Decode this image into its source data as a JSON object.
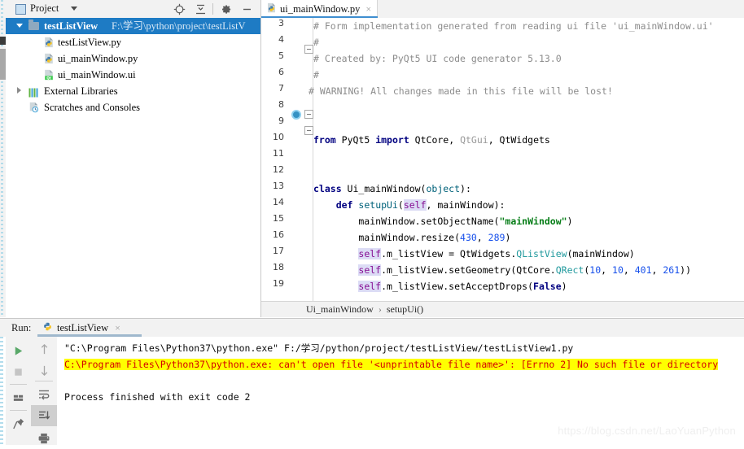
{
  "project_panel": {
    "title": "Project",
    "icons": [
      "locate-target-icon",
      "collapse-all-icon",
      "settings-gear-icon",
      "minimize-icon"
    ],
    "tree": [
      {
        "label": "testListView",
        "path": "F:\\学习\\python\\project\\testListV",
        "icon": "folder-icon",
        "expanded": true,
        "selected": true,
        "indent": 0
      },
      {
        "label": "testListView.py",
        "path": "",
        "icon": "python-file-icon",
        "expanded": null,
        "selected": false,
        "indent": 1
      },
      {
        "label": "ui_mainWindow.py",
        "path": "",
        "icon": "python-file-icon",
        "expanded": null,
        "selected": false,
        "indent": 1
      },
      {
        "label": "ui_mainWindow.ui",
        "path": "",
        "icon": "qt-designer-file-icon",
        "expanded": null,
        "selected": false,
        "indent": 1
      },
      {
        "label": "External Libraries",
        "path": "",
        "icon": "libraries-icon",
        "expanded": false,
        "selected": false,
        "indent": 0
      },
      {
        "label": "Scratches and Consoles",
        "path": "",
        "icon": "scratches-icon",
        "expanded": null,
        "selected": false,
        "indent": 0
      }
    ]
  },
  "editor": {
    "tab": {
      "name": "ui_mainWindow.py",
      "icon": "python-file-icon",
      "close": "×"
    },
    "first_line_number": 3,
    "lines": [
      {
        "n": 3,
        "tokens": [
          {
            "t": "# Form implementation generated from reading ui file 'ui_mainWindow.ui'",
            "c": "cmt"
          }
        ],
        "indent": 0
      },
      {
        "n": 4,
        "tokens": [
          {
            "t": "#",
            "c": "cmt"
          }
        ],
        "indent": 0
      },
      {
        "n": 5,
        "tokens": [
          {
            "t": "# Created by: PyQt5 UI code generator 5.13.0",
            "c": "cmt"
          }
        ],
        "indent": 0
      },
      {
        "n": 6,
        "tokens": [
          {
            "t": "#",
            "c": "cmt"
          }
        ],
        "indent": 0
      },
      {
        "n": 7,
        "tokens": [
          {
            "t": "# WARNING! All changes made in this file will be lost!",
            "c": "cmt"
          }
        ],
        "indent": -1
      },
      {
        "n": 8,
        "tokens": [],
        "indent": 0
      },
      {
        "n": 9,
        "tokens": [],
        "indent": 0
      },
      {
        "n": 10,
        "tokens": [
          {
            "t": "from",
            "c": "k"
          },
          {
            "t": " ",
            "c": "id"
          },
          {
            "t": "PyQt5",
            "c": "id"
          },
          {
            "t": " ",
            "c": "id"
          },
          {
            "t": "import",
            "c": "k"
          },
          {
            "t": " QtCore, ",
            "c": "id"
          },
          {
            "t": "QtGui",
            "c": "grey"
          },
          {
            "t": ", QtWidgets",
            "c": "id"
          }
        ],
        "indent": 0
      },
      {
        "n": 11,
        "tokens": [],
        "indent": 0
      },
      {
        "n": 12,
        "tokens": [],
        "indent": 0
      },
      {
        "n": 13,
        "tokens": [
          {
            "t": "class",
            "c": "k"
          },
          {
            "t": " Ui_mainWindow(",
            "c": "id"
          },
          {
            "t": "object",
            "c": "fn"
          },
          {
            "t": "):",
            "c": "id"
          }
        ],
        "indent": 0
      },
      {
        "n": 14,
        "tokens": [
          {
            "t": "    ",
            "c": "id"
          },
          {
            "t": "def",
            "c": "k"
          },
          {
            "t": " ",
            "c": "id"
          },
          {
            "t": "setupUi",
            "c": "fn"
          },
          {
            "t": "(",
            "c": "id"
          },
          {
            "t": "self",
            "c": "selfhl"
          },
          {
            "t": ", mainWindow):",
            "c": "id"
          }
        ],
        "indent": 0
      },
      {
        "n": 15,
        "tokens": [
          {
            "t": "        mainWindow.setObjectName(",
            "c": "id"
          },
          {
            "t": "\"mainWindow\"",
            "c": "str"
          },
          {
            "t": ")",
            "c": "id"
          }
        ],
        "indent": 0
      },
      {
        "n": 16,
        "tokens": [
          {
            "t": "        mainWindow.resize(",
            "c": "id"
          },
          {
            "t": "430",
            "c": "num"
          },
          {
            "t": ", ",
            "c": "id"
          },
          {
            "t": "289",
            "c": "num"
          },
          {
            "t": ")",
            "c": "id"
          }
        ],
        "indent": 0
      },
      {
        "n": 17,
        "tokens": [
          {
            "t": "        ",
            "c": "id"
          },
          {
            "t": "self",
            "c": "selfhl"
          },
          {
            "t": ".m_listView = QtWidgets.",
            "c": "id"
          },
          {
            "t": "QListView",
            "c": "blue"
          },
          {
            "t": "(mainWindow)",
            "c": "id"
          }
        ],
        "indent": 0
      },
      {
        "n": 18,
        "tokens": [
          {
            "t": "        ",
            "c": "id"
          },
          {
            "t": "self",
            "c": "selfhl"
          },
          {
            "t": ".m_listView.setGeometry(QtCore.",
            "c": "id"
          },
          {
            "t": "QRect",
            "c": "blue"
          },
          {
            "t": "(",
            "c": "id"
          },
          {
            "t": "10",
            "c": "num"
          },
          {
            "t": ", ",
            "c": "id"
          },
          {
            "t": "10",
            "c": "num"
          },
          {
            "t": ", ",
            "c": "id"
          },
          {
            "t": "401",
            "c": "num"
          },
          {
            "t": ", ",
            "c": "id"
          },
          {
            "t": "261",
            "c": "num"
          },
          {
            "t": "))",
            "c": "id"
          }
        ],
        "indent": 0
      },
      {
        "n": 19,
        "tokens": [
          {
            "t": "        ",
            "c": "id"
          },
          {
            "t": "self",
            "c": "selfhl"
          },
          {
            "t": ".m_listView.setAcceptDrops(",
            "c": "id"
          },
          {
            "t": "False",
            "c": "k"
          },
          {
            "t": ")",
            "c": "id"
          }
        ],
        "indent": 0
      }
    ]
  },
  "breadcrumb": {
    "class_name": "Ui_mainWindow",
    "separator": "›",
    "method_name": "setupUi()"
  },
  "run_panel": {
    "label": "Run:",
    "tab_name": "testListView",
    "tab_close": "×",
    "tools_left": [
      "run-icon",
      "stop-icon",
      "layout-icon",
      "pin-icon"
    ],
    "tools_right": [
      "scroll-up-icon",
      "scroll-down-icon",
      "soft-wrap-icon",
      "scroll-to-end-icon",
      "print-icon"
    ],
    "console": [
      {
        "text": "\"C:\\Program Files\\Python37\\python.exe\" F:/学习/python/project/testListView/testListView1.py",
        "highlight": false
      },
      {
        "text": "C:\\Program Files\\Python37\\python.exe: can't open file '<unprintable file name>': [Errno 2] No such file or directory",
        "highlight": true
      },
      {
        "text": "",
        "highlight": false
      },
      {
        "text": "Process finished with exit code 2",
        "highlight": false
      }
    ]
  },
  "watermark": "https://blog.csdn.net/LaoYuanPython",
  "colors": {
    "selection_blue": "#1e7bc4",
    "highlight_yellow": "#ffff00",
    "error_red": "#d40000",
    "panel_grey": "#f2f2f2",
    "run_green": "#59a869"
  }
}
